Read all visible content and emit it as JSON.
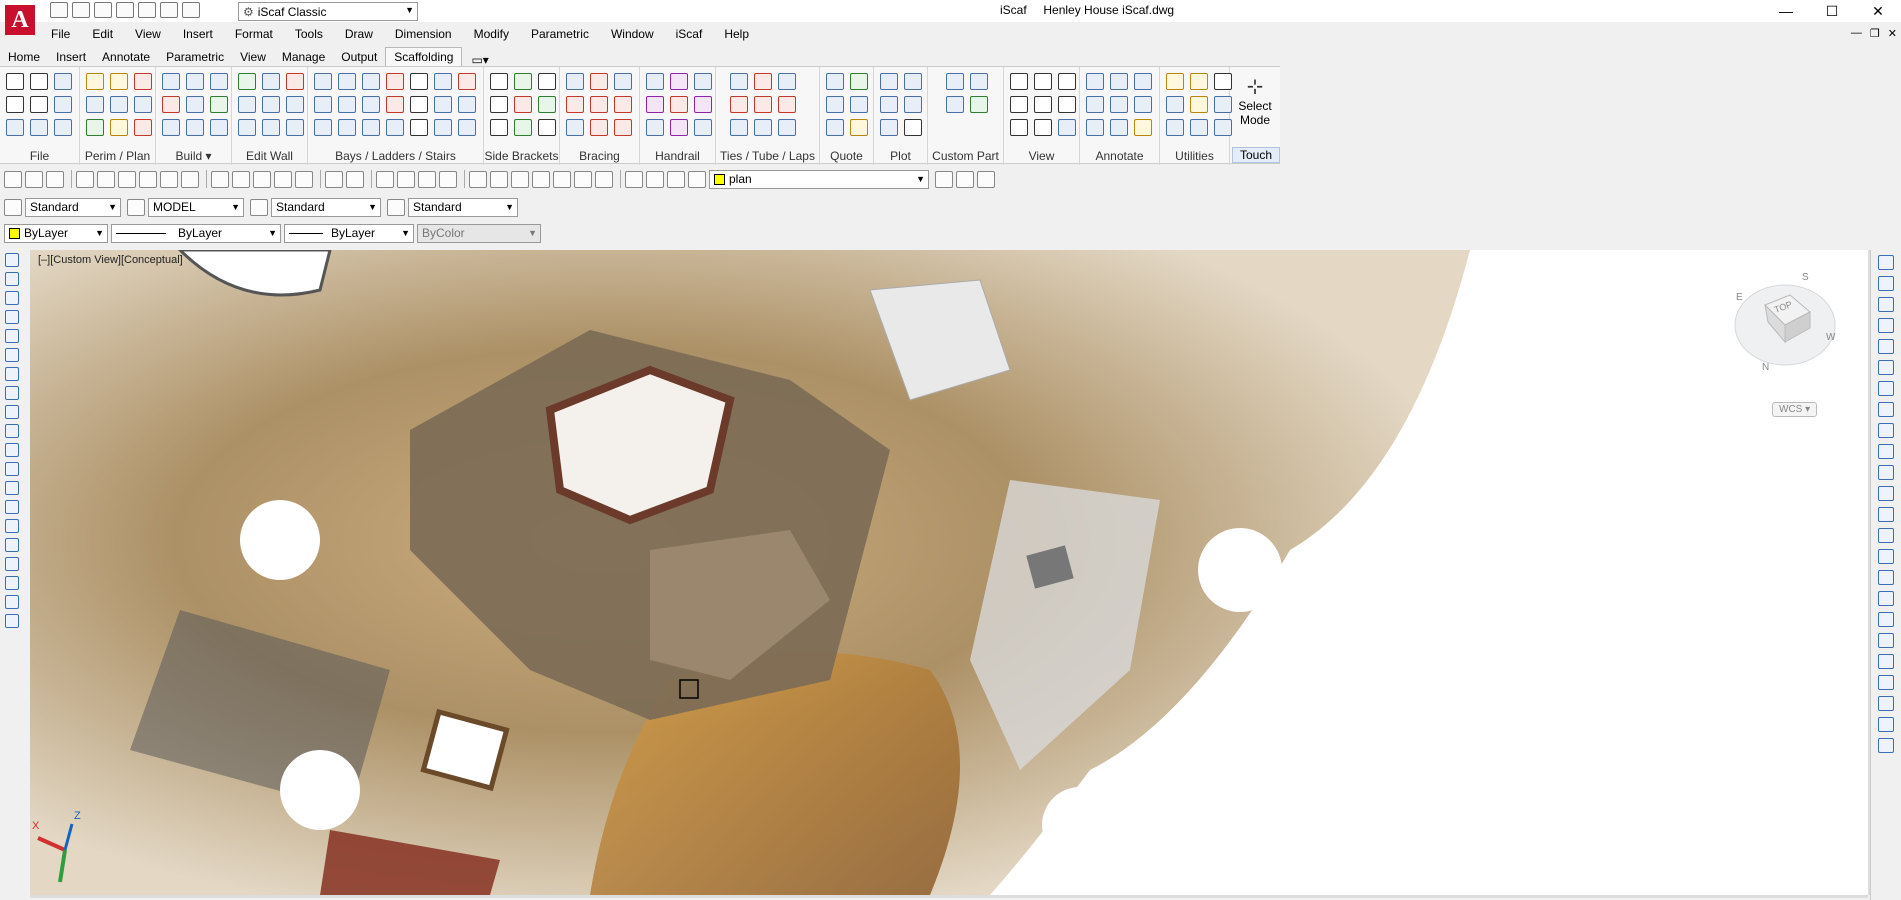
{
  "app": {
    "name": "iScaf",
    "file": "Henley House iScaf.dwg",
    "logo_letter": "A",
    "workspace": "iScaf Classic"
  },
  "menubar": [
    "File",
    "Edit",
    "View",
    "Insert",
    "Format",
    "Tools",
    "Draw",
    "Dimension",
    "Modify",
    "Parametric",
    "Window",
    "iScaf",
    "Help"
  ],
  "ribbon_tabs": [
    "Home",
    "Insert",
    "Annotate",
    "Parametric",
    "View",
    "Manage",
    "Output",
    "Scaffolding"
  ],
  "active_tab": "Scaffolding",
  "ribbon_panels": [
    "File",
    "Perim / Plan",
    "Build ▾",
    "Edit Wall",
    "Bays / Ladders / Stairs",
    "Side Brackets",
    "Bracing",
    "Handrail",
    "Ties / Tube / Laps",
    "Quote",
    "Plot",
    "Custom Part",
    "View",
    "Annotate",
    "Utilities",
    "Touch"
  ],
  "select_mode": {
    "line1": "Select",
    "line2": "Mode"
  },
  "layer_dropdown": "plan",
  "properties_row1": {
    "text_style": "Standard",
    "model": "MODEL",
    "dim_style": "Standard",
    "table_style": "Standard"
  },
  "properties_row2": {
    "color": "ByLayer",
    "linetype": "ByLayer",
    "lineweight": "ByLayer",
    "plotstyle": "ByColor"
  },
  "viewport": {
    "label": "[–][Custom View][Conceptual]",
    "viewcube": {
      "face": "TOP",
      "compass": [
        "S",
        "E",
        "W",
        "N"
      ]
    },
    "wcs": "WCS",
    "ucs": {
      "x": "X",
      "z": "Z"
    }
  },
  "colors": {
    "accent": "#c8102e",
    "tab_active_border": "#b8b8b8"
  }
}
